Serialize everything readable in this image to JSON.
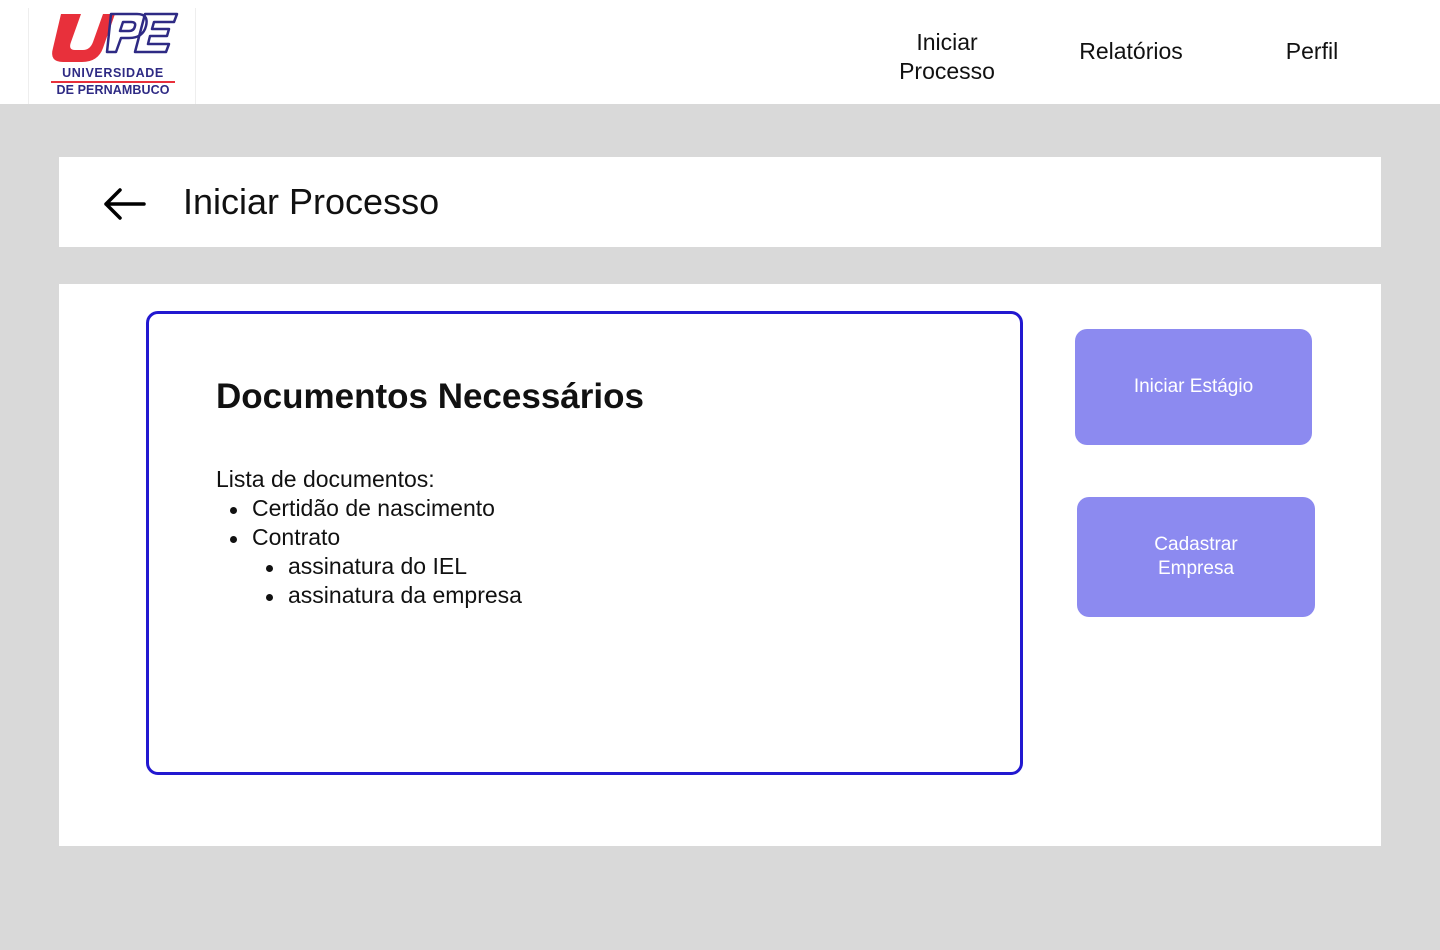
{
  "header": {
    "logo": {
      "mark": "UPE",
      "line1": "UNIVERSIDADE",
      "line2": "DE PERNAMBUCO",
      "colors": {
        "red": "#e8303b",
        "navy": "#2e2a84"
      }
    },
    "nav": [
      {
        "label": "Iniciar Processo"
      },
      {
        "label": "Relatórios"
      },
      {
        "label": "Perfil"
      }
    ]
  },
  "page": {
    "back_icon": "arrow-left-icon",
    "title": "Iniciar Processo"
  },
  "documents": {
    "title": "Documentos Necessários",
    "intro": "Lista de documentos:",
    "items": [
      {
        "label": "Certidão de nascimento",
        "level": 1
      },
      {
        "label": "Contrato",
        "level": 1
      },
      {
        "label": "assinatura do IEL",
        "level": 2
      },
      {
        "label": "assinatura da empresa",
        "level": 2
      }
    ],
    "border_color": "#2218d0"
  },
  "actions": [
    {
      "label": "Iniciar Estágio"
    },
    {
      "label": "Cadastrar Empresa"
    }
  ],
  "colors": {
    "background": "#d9d9d9",
    "card": "#ffffff",
    "button": "#8c8af0",
    "button_text": "#ffffff"
  }
}
